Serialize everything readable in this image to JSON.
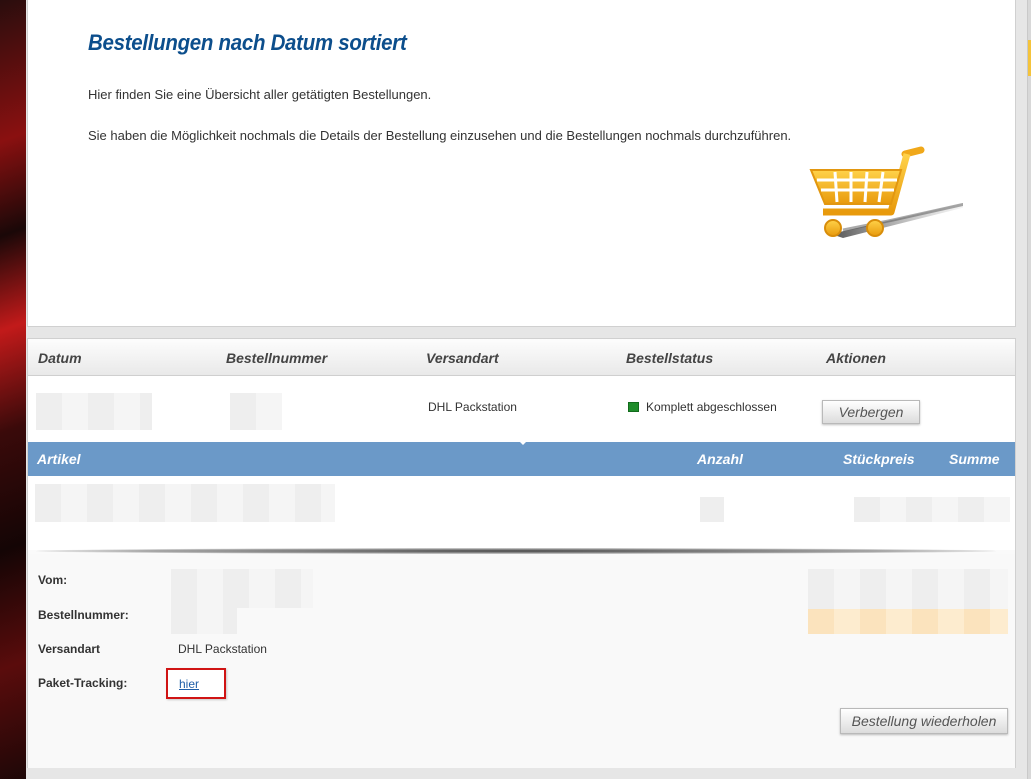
{
  "intro": {
    "title": "Bestellungen nach Datum sortiert",
    "text1": "Hier finden Sie eine Übersicht aller getätigten Bestellungen.",
    "text2": "Sie haben die Möglichkeit nochmals die Details der Bestellung einzusehen und die Bestellungen nochmals durchzuführen.",
    "image_icon": "shopping-cart-icon"
  },
  "orders_table": {
    "headers": [
      "Datum",
      "Bestellnummer",
      "Versandart",
      "Bestellstatus",
      "Aktionen"
    ],
    "row": {
      "shipping": "DHL Packstation",
      "status": "Komplett abgeschlossen",
      "status_color": "#1f8d2b",
      "action_label": "Verbergen"
    }
  },
  "articles_table": {
    "headers": [
      "Artikel",
      "Anzahl",
      "Stückpreis",
      "Summe"
    ],
    "header_color": "#6b99c8"
  },
  "details": {
    "from_label": "Vom:",
    "order_number_label": "Bestellnummer:",
    "shipping_label": "Versandart",
    "shipping_value": "DHL Packstation",
    "tracking_label": "Paket-Tracking:",
    "tracking_link": "hier",
    "repeat_label": "Bestellung wiederholen"
  },
  "colors": {
    "title_blue": "#0c4e8c",
    "highlight_red": "#d01414",
    "cart_yellow": "#f4b41a"
  }
}
